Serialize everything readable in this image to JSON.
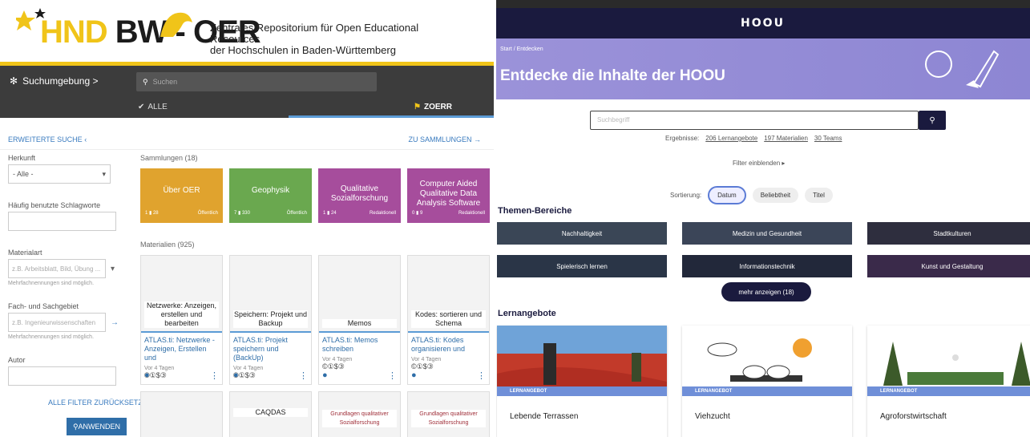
{
  "left": {
    "logo_text": "BW - OER",
    "logo_hnd": "HND",
    "subtitle_line1": "Zentrales Repositorium für Open Educational Resources",
    "subtitle_line2": "der Hochschulen in Baden-Württemberg",
    "nav_label": "Suchumgebung >",
    "search_placeholder": "Suchen",
    "tab_all": "ALLE",
    "tab_zoerr": "ZOERR",
    "advanced_search": "ERWEITERTE SUCHE",
    "to_collections": "ZU SAMMLUNGEN",
    "filters": {
      "herkunft_label": "Herkunft",
      "herkunft_value": "- Alle -",
      "schlagworte_label": "Häufig benutzte Schlagworte",
      "materialart_label": "Materialart",
      "materialart_placeholder": "z.B. Arbeitsblatt, Bild, Übung ...",
      "materialart_note": "Mehrfachnennungen sind möglich.",
      "fach_label": "Fach- und Sachgebiet",
      "fach_placeholder": "z.B. Ingenieurwissenschaften",
      "fach_note": "Mehrfachnennungen sind möglich.",
      "autor_label": "Autor",
      "reset": "ALLE FILTER ZURÜCKSETZEN",
      "apply": "ANWENDEN"
    },
    "collections_heading": "Sammlungen (18)",
    "collections": [
      {
        "title": "Über OER",
        "color": "#e0a32e",
        "meta_left": "1 ▮ 28",
        "meta_right": "Öffentlich"
      },
      {
        "title": "Geophysik",
        "color": "#6aa84f",
        "meta_left": "7 ▮ 330",
        "meta_right": "Öffentlich"
      },
      {
        "title": "Qualitative Sozialforschung",
        "color": "#a64d9c",
        "meta_left": "1 ▮ 24",
        "meta_right": "Redaktionell"
      },
      {
        "title": "Computer Aided Qualitative Data Analysis Software",
        "color": "#a64d9c",
        "meta_left": "0 ▮ 9",
        "meta_right": "Redaktionell"
      }
    ],
    "materials_heading": "Materialien (925)",
    "materials": [
      {
        "caption": "Netzwerke: Anzeigen, erstellen und bearbeiten",
        "title": "ATLAS.ti: Netzwerke - Anzeigen, Erstellen und",
        "date": "Vor 4 Tagen",
        "cc": "©①$③"
      },
      {
        "caption": "Speichern: Projekt und Backup",
        "title": "ATLAS.ti: Projekt speichern und (BackUp)",
        "date": "Vor 4 Tagen",
        "cc": "©①$③"
      },
      {
        "caption": "Memos",
        "title": "ATLAS.ti: Memos schreiben",
        "date": "Vor 4 Tagen",
        "cc": "©①$③"
      },
      {
        "caption": "Kodes: sortieren und Schema",
        "title": "ATLAS.ti: Kodes organisieren und",
        "date": "Vor 4 Tagen",
        "cc": "©①$③"
      }
    ],
    "materials2": [
      {
        "caption": ""
      },
      {
        "caption": "CAQDAS"
      },
      {
        "caption": "Grundlagen qualitativer Sozialforschung"
      },
      {
        "caption": "Grundlagen qualitativer Sozialforschung"
      }
    ]
  },
  "right": {
    "logo": "HOOU",
    "breadcrumb": "Start / Entdecken",
    "title": "Entdecke die Inhalte der HOOU",
    "search_placeholder": "Suchbegriff",
    "results_label": "Ergebnisse:",
    "results": [
      "206 Lernangebote",
      "197 Materialien",
      "30 Teams"
    ],
    "filter_toggle": "Filter einblenden",
    "sort_label": "Sortierung:",
    "sort_options": [
      "Datum",
      "Beliebtheit",
      "Titel"
    ],
    "themes_heading": "Themen-Bereiche",
    "themes": [
      "Nachhaltigkeit",
      "Medizin und Gesundheit",
      "Stadtkulturen",
      "Spielerisch lernen",
      "Informationstechnik",
      "Kunst und Gestaltung"
    ],
    "more": "mehr anzeigen (18)",
    "courses_heading": "Lernangebote",
    "course_tag": "LERNANGEBOT",
    "courses": [
      "Lebende Terrassen",
      "Viehzucht",
      "Agroforstwirtschaft"
    ]
  }
}
